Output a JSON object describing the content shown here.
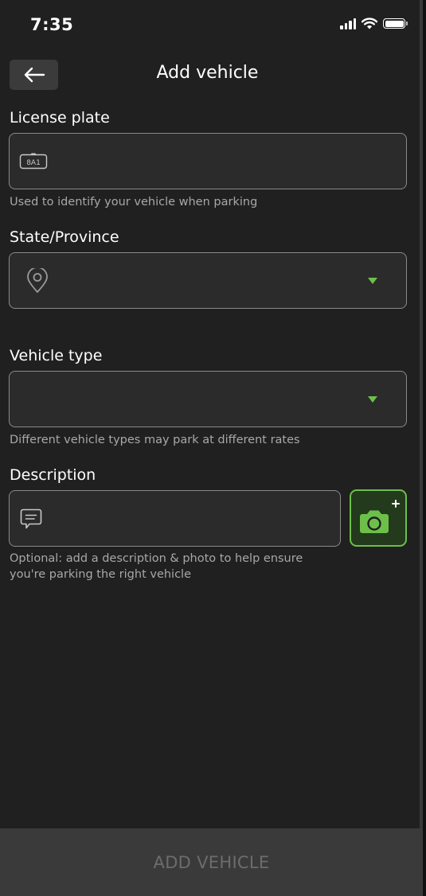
{
  "status_bar": {
    "time": "7:35"
  },
  "header": {
    "title": "Add vehicle",
    "back_icon": "arrow-left-icon"
  },
  "form": {
    "license_plate": {
      "label": "License plate",
      "value": "",
      "icon": "license-plate-icon",
      "icon_text": "8A1",
      "helper": "Used to identify your vehicle when parking"
    },
    "state_province": {
      "label": "State/Province",
      "value": "",
      "icon": "location-pin-icon"
    },
    "vehicle_type": {
      "label": "Vehicle type",
      "value": "",
      "helper": "Different vehicle types may park at different rates"
    },
    "description": {
      "label": "Description",
      "value": "",
      "icon": "message-icon",
      "helper_line1": "Optional: add a description & photo to help ensure",
      "helper_line2": "you're parking the right vehicle"
    },
    "camera_icon": "camera-add-icon"
  },
  "footer": {
    "add_vehicle_label": "ADD VEHICLE"
  },
  "colors": {
    "background": "#202020",
    "accent": "#6cc04a",
    "field_background": "#2b2b2b",
    "field_border": "#8a8a8a",
    "disabled_text": "#6c6c6c"
  }
}
